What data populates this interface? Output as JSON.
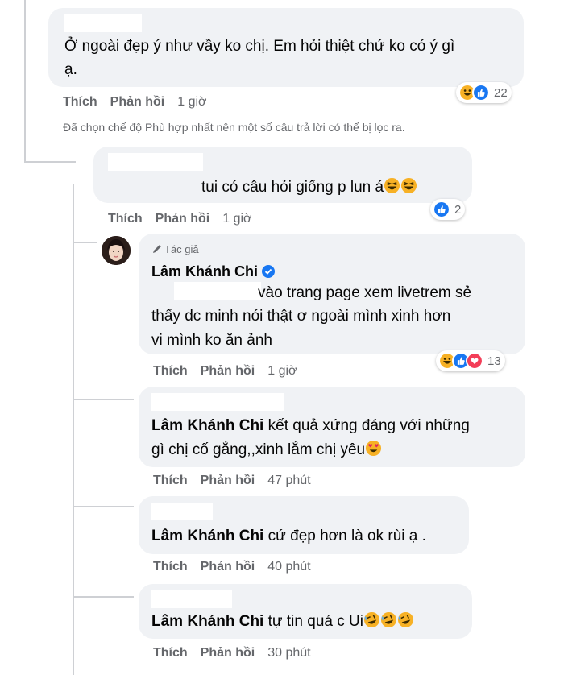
{
  "comments": [
    {
      "text": "Ở ngoài đẹp ý như vầy ko chị. Em hỏi thiệt chứ ko có ý gì",
      "text_line2": "ạ.",
      "actions": {
        "like": "Thích",
        "reply": "Phản hồi",
        "time": "1 giờ"
      },
      "reactions": {
        "icons": [
          "haha-icon",
          "like-icon"
        ],
        "count": "22"
      },
      "filter_notice": "Đã chọn chế độ Phù hợp nhất nên một số câu trả lời có thể bị lọc ra."
    },
    {
      "text": "tui có câu hỏi giống p lun á",
      "actions": {
        "like": "Thích",
        "reply": "Phản hồi",
        "time": "1 giờ"
      },
      "reactions": {
        "icons": [
          "like-icon"
        ],
        "count": "2"
      }
    },
    {
      "badge": "Tác giả",
      "author": "Lâm Khánh Chi",
      "verified": true,
      "line1": "vào trang page xem livetrem sẻ",
      "line2": "thấy dc minh nói thật ơ ngoài mình xinh hơn",
      "line3": "vi mình ko ăn ảnh",
      "actions": {
        "like": "Thích",
        "reply": "Phản hồi",
        "time": "1 giờ"
      },
      "reactions": {
        "icons": [
          "haha-icon",
          "like-icon",
          "love-icon"
        ],
        "count": "13"
      }
    },
    {
      "mention": "Lâm Khánh Chi",
      "line1": "kết quả xứng đáng với những",
      "line2": "gì chị cố gắng,,xinh lắm chị yêu",
      "actions": {
        "like": "Thích",
        "reply": "Phản hồi",
        "time": "47 phút"
      }
    },
    {
      "mention": "Lâm Khánh Chi",
      "line1": "cứ đẹp hơn là ok rùi ạ .",
      "actions": {
        "like": "Thích",
        "reply": "Phản hồi",
        "time": "40 phút"
      }
    },
    {
      "mention": "Lâm Khánh Chi",
      "line1": "tự tin quá c Ui",
      "actions": {
        "like": "Thích",
        "reply": "Phản hồi",
        "time": "30 phút"
      }
    }
  ],
  "colors": {
    "like": "#1877f2",
    "love": "#f33e58",
    "haha": "#f7b125",
    "verified": "#1877f2",
    "bubble": "#f0f2f5",
    "meta": "#65676b"
  }
}
